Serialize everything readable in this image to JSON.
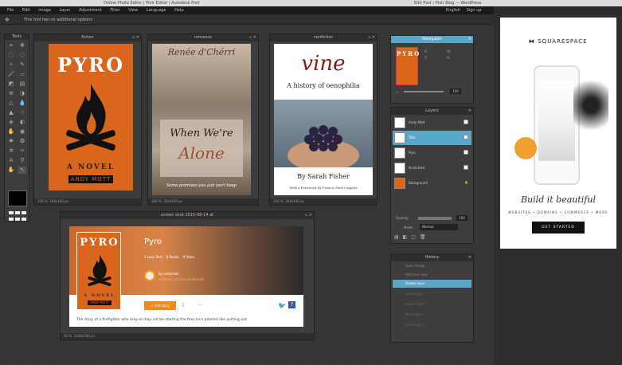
{
  "titlebar": {
    "left": "Online Photo Editor | Pixlr Editor | Autodesk Pixlr",
    "right": "Edit Post ‹ Pixlr Blog — WordPress"
  },
  "menu": [
    "File",
    "Edit",
    "Image",
    "Layer",
    "Adjustment",
    "Filter",
    "View",
    "Language",
    "Help"
  ],
  "account": {
    "english": "English",
    "signup": "Sign up"
  },
  "options_hint": "This tool has no additional options",
  "toolbox_title": "Tools",
  "windows": {
    "fiction": {
      "title": "fiction",
      "zoom": "100",
      "size": "264x440 px",
      "cover": {
        "title": "PYRO",
        "subtitle": "A NOVEL",
        "author": "ANDY MOTT",
        "bg": "#d9661c"
      }
    },
    "romance": {
      "title": "romance",
      "zoom": "100",
      "size": "264x440 px",
      "cover": {
        "author": "Renée d'Chérri",
        "title1": "When We're",
        "title2": "Alone",
        "tagline": "Some promises you just can't keep"
      }
    },
    "nonfiction": {
      "title": "nonfiction",
      "zoom": "100",
      "size": "264x440 px",
      "cover": {
        "title": "vine",
        "subtitle": "A history of oenophilia",
        "author": "By Sarah Fisher",
        "foreword": "With a Foreword by Francis Ford Coppola"
      }
    },
    "screenshot": {
      "title": "screen shot 2015-08-14 at",
      "zoom": "50",
      "size": "1344x780 px",
      "book": {
        "title": "Pyro",
        "meta": [
          "1 Loan Part",
          "8 Reads",
          "9 Votes"
        ],
        "author": "by andymott",
        "author_link": "wattpad.com/user/andymott",
        "add_button": "+ Add story",
        "blurb": "The story of a firefighter who may or may not be starting the fires he's planted like putting out."
      }
    }
  },
  "navigator": {
    "title": "Navigator",
    "x_label": "X:",
    "y_label": "Y:",
    "w_label": "W:",
    "h_label": "H:",
    "zoom": "100"
  },
  "layers": {
    "title": "Layers",
    "items": [
      "Andy Mott",
      "Title",
      "Pyro",
      "Illustrated",
      "Background"
    ],
    "opacity_label": "Opacity:",
    "opacity_value": "100",
    "mode_label": "Mode:",
    "mode_value": "Normal"
  },
  "history": {
    "title": "History",
    "items": [
      "Open Image",
      "Add new layer",
      "Delete layer",
      "Select layer",
      "Select layer",
      "Move layer",
      "Select layer"
    ]
  },
  "ad": {
    "brand": "SQUARESPACE",
    "script": "Build it beautiful",
    "tagline": "WEBSITES • DOMAINS • COMMERCE • MORE",
    "cta": "GET STARTED"
  }
}
